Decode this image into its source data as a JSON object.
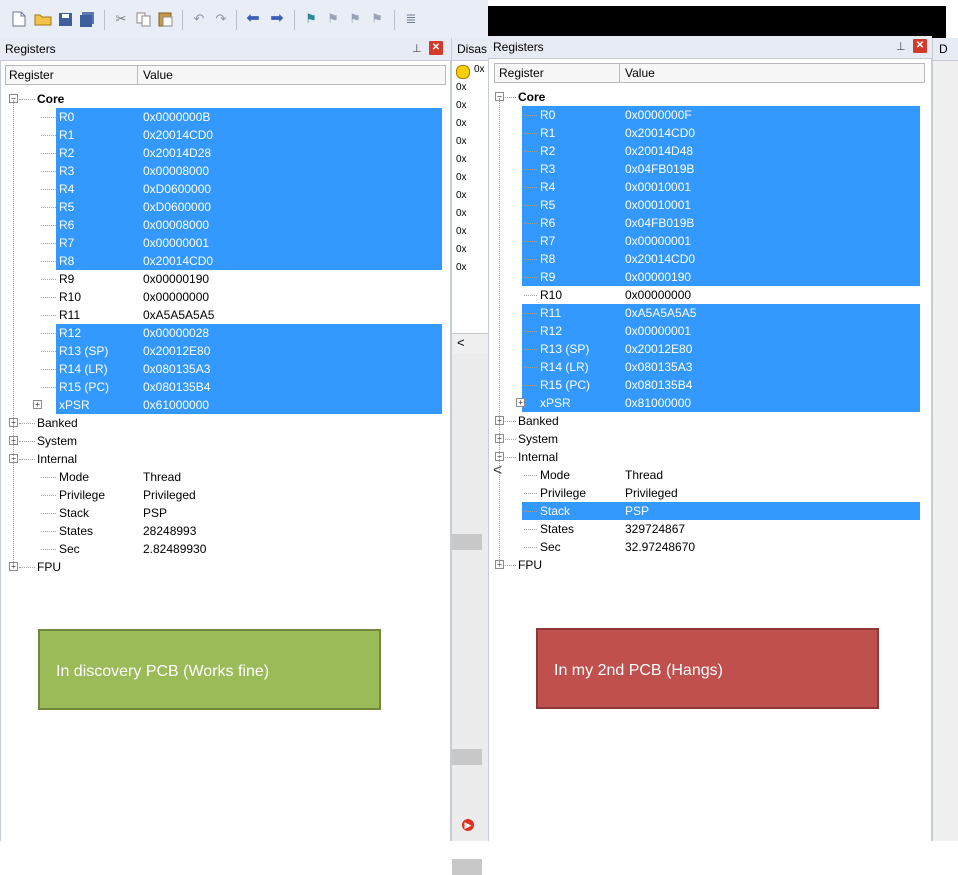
{
  "toolbar": {
    "icons": [
      "new-file-icon",
      "open-folder-icon",
      "save-icon",
      "save-all-icon",
      "cut-icon",
      "copy-icon",
      "paste-icon",
      "undo-icon",
      "redo-icon",
      "nav-back-icon",
      "nav-forward-icon",
      "bookmark-icon",
      "bookmark-prev-icon",
      "bookmark-next-icon",
      "bookmark-clear-icon",
      "indent-icon"
    ]
  },
  "left_panel": {
    "title": "Registers",
    "pin_glyph": "⊥",
    "close_glyph": "✕",
    "col_register": "Register",
    "col_value": "Value",
    "rows": [
      {
        "name": "Core",
        "value": "",
        "level": 0,
        "expand": "−",
        "sel": false,
        "bold": true
      },
      {
        "name": "R0",
        "value": "0x0000000B",
        "level": 1,
        "sel": true
      },
      {
        "name": "R1",
        "value": "0x20014CD0",
        "level": 1,
        "sel": true
      },
      {
        "name": "R2",
        "value": "0x20014D28",
        "level": 1,
        "sel": true
      },
      {
        "name": "R3",
        "value": "0x00008000",
        "level": 1,
        "sel": true
      },
      {
        "name": "R4",
        "value": "0xD0600000",
        "level": 1,
        "sel": true
      },
      {
        "name": "R5",
        "value": "0xD0600000",
        "level": 1,
        "sel": true
      },
      {
        "name": "R6",
        "value": "0x00008000",
        "level": 1,
        "sel": true
      },
      {
        "name": "R7",
        "value": "0x00000001",
        "level": 1,
        "sel": true
      },
      {
        "name": "R8",
        "value": "0x20014CD0",
        "level": 1,
        "sel": true
      },
      {
        "name": "R9",
        "value": "0x00000190",
        "level": 1,
        "sel": false
      },
      {
        "name": "R10",
        "value": "0x00000000",
        "level": 1,
        "sel": false
      },
      {
        "name": "R11",
        "value": "0xA5A5A5A5",
        "level": 1,
        "sel": false
      },
      {
        "name": "R12",
        "value": "0x00000028",
        "level": 1,
        "sel": true
      },
      {
        "name": "R13 (SP)",
        "value": "0x20012E80",
        "level": 1,
        "sel": true
      },
      {
        "name": "R14 (LR)",
        "value": "0x080135A3",
        "level": 1,
        "sel": true
      },
      {
        "name": "R15 (PC)",
        "value": "0x080135B4",
        "level": 1,
        "sel": true
      },
      {
        "name": "xPSR",
        "value": "0x61000000",
        "level": 1,
        "expand": "+",
        "sel": true
      },
      {
        "name": "Banked",
        "value": "",
        "level": 0,
        "expand": "+",
        "sel": false
      },
      {
        "name": "System",
        "value": "",
        "level": 0,
        "expand": "+",
        "sel": false
      },
      {
        "name": "Internal",
        "value": "",
        "level": 0,
        "expand": "−",
        "sel": false
      },
      {
        "name": "Mode",
        "value": "Thread",
        "level": 1,
        "sel": false
      },
      {
        "name": "Privilege",
        "value": "Privileged",
        "level": 1,
        "sel": false
      },
      {
        "name": "Stack",
        "value": "PSP",
        "level": 1,
        "sel": false
      },
      {
        "name": "States",
        "value": "28248993",
        "level": 1,
        "sel": false
      },
      {
        "name": "Sec",
        "value": "2.82489930",
        "level": 1,
        "sel": false
      },
      {
        "name": "FPU",
        "value": "",
        "level": 0,
        "expand": "+",
        "sel": false
      }
    ]
  },
  "disassembly": {
    "title": "Disas",
    "lines": [
      "0x",
      "0x",
      "0x",
      "0x",
      "0x",
      "0x",
      "0x",
      "0x",
      "0x",
      "0x",
      "0x",
      "0x"
    ],
    "scroll_left": "<"
  },
  "right_panel": {
    "title": "Registers",
    "pin_glyph": "⊥",
    "close_glyph": "✕",
    "col_register": "Register",
    "col_value": "Value",
    "rows": [
      {
        "name": "Core",
        "value": "",
        "level": 0,
        "expand": "−",
        "sel": false,
        "bold": true
      },
      {
        "name": "R0",
        "value": "0x0000000F",
        "level": 1,
        "sel": true
      },
      {
        "name": "R1",
        "value": "0x20014CD0",
        "level": 1,
        "sel": true
      },
      {
        "name": "R2",
        "value": "0x20014D48",
        "level": 1,
        "sel": true
      },
      {
        "name": "R3",
        "value": "0x04FB019B",
        "level": 1,
        "sel": true
      },
      {
        "name": "R4",
        "value": "0x00010001",
        "level": 1,
        "sel": true
      },
      {
        "name": "R5",
        "value": "0x00010001",
        "level": 1,
        "sel": true
      },
      {
        "name": "R6",
        "value": "0x04FB019B",
        "level": 1,
        "sel": true
      },
      {
        "name": "R7",
        "value": "0x00000001",
        "level": 1,
        "sel": true
      },
      {
        "name": "R8",
        "value": "0x20014CD0",
        "level": 1,
        "sel": true
      },
      {
        "name": "R9",
        "value": "0x00000190",
        "level": 1,
        "sel": true
      },
      {
        "name": "R10",
        "value": "0x00000000",
        "level": 1,
        "sel": false
      },
      {
        "name": "R11",
        "value": "0xA5A5A5A5",
        "level": 1,
        "sel": true
      },
      {
        "name": "R12",
        "value": "0x00000001",
        "level": 1,
        "sel": true
      },
      {
        "name": "R13 (SP)",
        "value": "0x20012E80",
        "level": 1,
        "sel": true
      },
      {
        "name": "R14 (LR)",
        "value": "0x080135A3",
        "level": 1,
        "sel": true
      },
      {
        "name": "R15 (PC)",
        "value": "0x080135B4",
        "level": 1,
        "sel": true
      },
      {
        "name": "xPSR",
        "value": "0x81000000",
        "level": 1,
        "expand": "+",
        "sel": true
      },
      {
        "name": "Banked",
        "value": "",
        "level": 0,
        "expand": "+",
        "sel": false
      },
      {
        "name": "System",
        "value": "",
        "level": 0,
        "expand": "+",
        "sel": false
      },
      {
        "name": "Internal",
        "value": "",
        "level": 0,
        "expand": "−",
        "sel": false
      },
      {
        "name": "Mode",
        "value": "Thread",
        "level": 1,
        "sel": false
      },
      {
        "name": "Privilege",
        "value": "Privileged",
        "level": 1,
        "sel": false
      },
      {
        "name": "Stack",
        "value": "PSP",
        "level": 1,
        "sel": true
      },
      {
        "name": "States",
        "value": "329724867",
        "level": 1,
        "sel": false
      },
      {
        "name": "Sec",
        "value": "32.97248670",
        "level": 1,
        "sel": false
      },
      {
        "name": "FPU",
        "value": "",
        "level": 0,
        "expand": "+",
        "sel": false
      }
    ],
    "collapse_arrow": "<"
  },
  "right_strip": {
    "title": "D"
  },
  "notes": {
    "discovery": "In discovery PCB (Works fine)",
    "second": "In my 2nd PCB (Hangs)"
  },
  "colors": {
    "selection": "#3399ff",
    "note_green": "#9bbb59",
    "note_green_border": "#71893f",
    "note_red": "#c0504d",
    "note_red_border": "#8c3836"
  }
}
